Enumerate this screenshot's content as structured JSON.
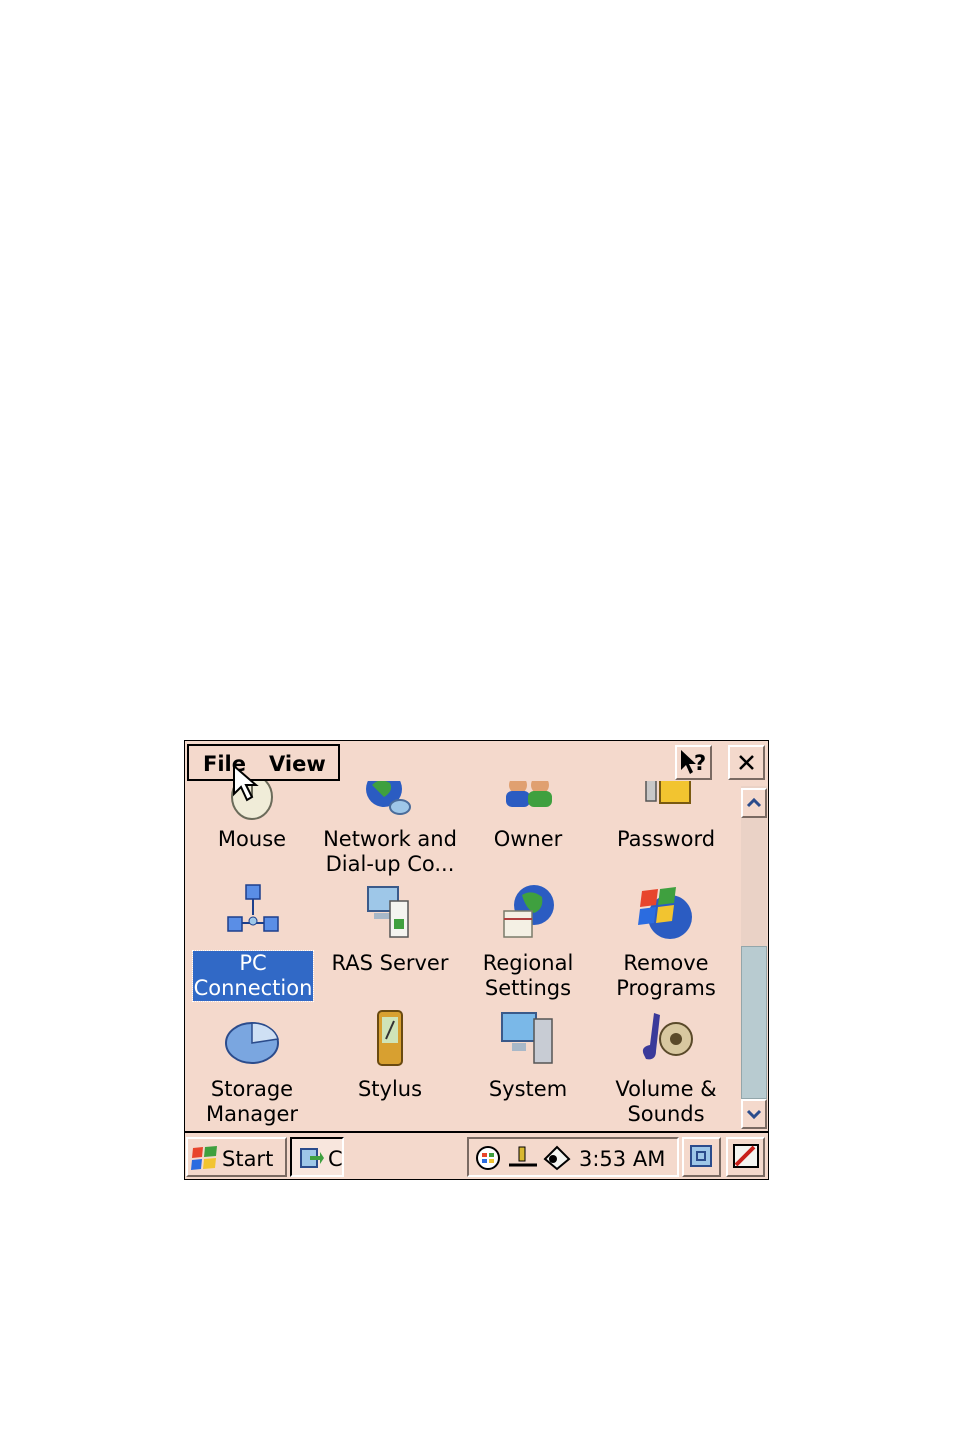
{
  "menu": {
    "file": "File",
    "view": "View"
  },
  "items": [
    {
      "label": "Mouse",
      "icon": "mouse-icon"
    },
    {
      "label": "Network and\nDial-up Co...",
      "icon": "network-icon"
    },
    {
      "label": "Owner",
      "icon": "owner-icon"
    },
    {
      "label": "Password",
      "icon": "password-icon"
    },
    {
      "label": "PC\nConnection",
      "icon": "pc-connection-icon",
      "selected": true
    },
    {
      "label": "RAS Server",
      "icon": "ras-server-icon"
    },
    {
      "label": "Regional\nSettings",
      "icon": "regional-settings-icon"
    },
    {
      "label": "Remove\nPrograms",
      "icon": "remove-programs-icon"
    },
    {
      "label": "Storage\nManager",
      "icon": "storage-manager-icon"
    },
    {
      "label": "Stylus",
      "icon": "stylus-icon"
    },
    {
      "label": "System",
      "icon": "system-icon"
    },
    {
      "label": "Volume &\nSounds",
      "icon": "volume-sounds-icon"
    }
  ],
  "taskbar": {
    "start_label": "Start",
    "task_label": "C",
    "clock": "3:53 AM"
  },
  "colors": {
    "background": "#f4d9cc",
    "selection": "#3169c6"
  }
}
